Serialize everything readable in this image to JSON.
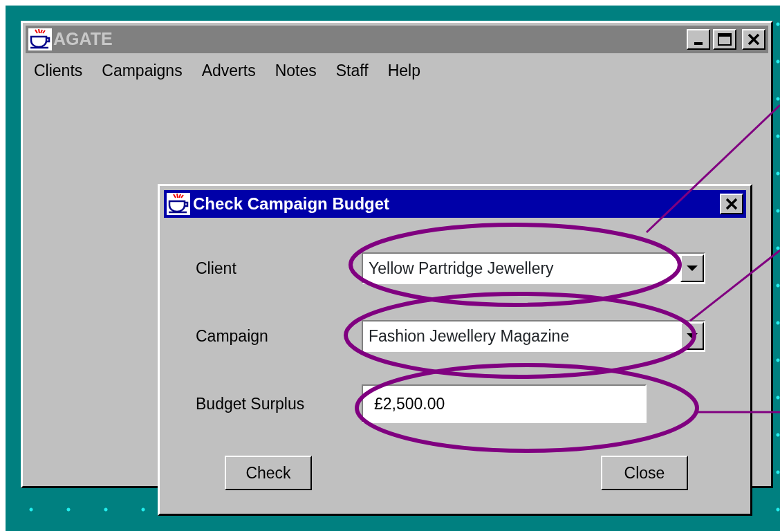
{
  "window": {
    "title": "AGATE"
  },
  "menu": [
    {
      "label": "Clients"
    },
    {
      "label": "Campaigns"
    },
    {
      "label": "Adverts"
    },
    {
      "label": "Notes"
    },
    {
      "label": "Staff"
    },
    {
      "label": "Help"
    }
  ],
  "dialog": {
    "title": "Check Campaign Budget",
    "fields": [
      {
        "label": "Client",
        "kind": "combo",
        "value": "Yellow Partridge Jewellery",
        "annotated": true
      },
      {
        "label": "Campaign",
        "kind": "combo",
        "value": "Fashion Jewellery Magazine",
        "annotated": true
      },
      {
        "label": "Budget Surplus",
        "kind": "text",
        "value": "£2,500.00",
        "annotated": true
      }
    ],
    "buttons": [
      {
        "label": "Check"
      },
      {
        "label": "Close"
      }
    ]
  }
}
